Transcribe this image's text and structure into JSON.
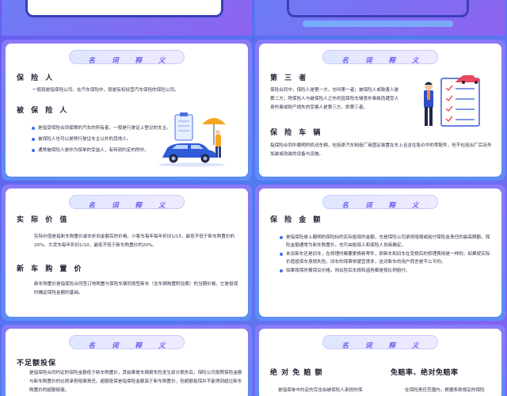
{
  "slides": {
    "s1": {
      "title": "名 词 释 义",
      "h1": "保 险 人",
      "p1": "一般就是指保险公司。在汽车保险中，就是有权经营汽车保险的保险公司。",
      "h2": "被 保 险 人",
      "bullets": [
        "是指受保险合同保障的汽车的所有者，一般是行驶证上登记的车主。",
        "被保险人也可以是除行驶证车主以外的其他人。",
        "通常被保险人是作为保单的受益人，有特别约定的除外。"
      ]
    },
    "s2": {
      "title": "名 词 释 义",
      "h1": "第 三 者",
      "p1": "保险合同中，保险人是第一方，也叫第一者；被保险人或致害人是第二方；除保险人与被保险人之外的因保险车辆意外事故而遭受人身伤害或财产损失的受害人是第三方，即第三者。",
      "h2": "保 险 车 辆",
      "p2": "指保险合同中载明的机动车辆，包括原汽车制造厂商固定装置在车上且含在售价中的零配件，但不包括出厂后另外加装或改装的设备与设施。"
    },
    "s3": {
      "title": "名 词 释 义",
      "h1": "实 际 价 值",
      "p1": "实际价值是指新车购置价减去折旧金额后的价格。小客车每年每年折旧1/15，最低不低于新车购置价的20%。大货车每年折旧1/10，最低不低于新车购置价的20%。",
      "h2": "新 车 购 置 价",
      "p2": "新车购置价是指保险合同签订地购置与保险车辆同类型新车（含车辆购置附加费）的当期价格，它是投保时确定保险金额的基础。"
    },
    "s4": {
      "title": "名 词 释 义",
      "h1": "保 险 金 额",
      "bullets": [
        "是指保险单上载明的保险标的实际投保的金额，也是保险公司承担赔偿或给付保险金责任的最高限额。保险金额通常为新车购置价，也可由投保人和保险人协商确定。",
        "未设新车还是旧车，在修理时都要更换新零件，即新车和旧车在受损后的修理费用是一样的。如果按实际价值投保车身损失险，旧车的保费将便宜很多，这对新车的用户而言是不公平的。",
        "如果按保时报保议价格，则出险后车损和盗抢都是按比例赔付。"
      ]
    },
    "s5": {
      "title": "名 词 释 义",
      "h1": "不足额投保",
      "p1": "是指保险合同约定的保险金额低于新车购置价，其结果是车辆损失险发生部分损失后，保险公司按照保险金额与新车购置价的比例承担赔偿责任。超额投保是指保险金额高于新车购置价，但超额投保并不能得到超过新车购置价的超额赔偿。"
    },
    "s6": {
      "title": "名 词 释 义",
      "h1": "绝 对 免 赔 额",
      "p1": "是指保单中约定的完全由被保险人承担的保",
      "h2": "免赔率、绝对免赔率",
      "p2": "在保险责任范围内，根据条款规定的保险"
    }
  }
}
